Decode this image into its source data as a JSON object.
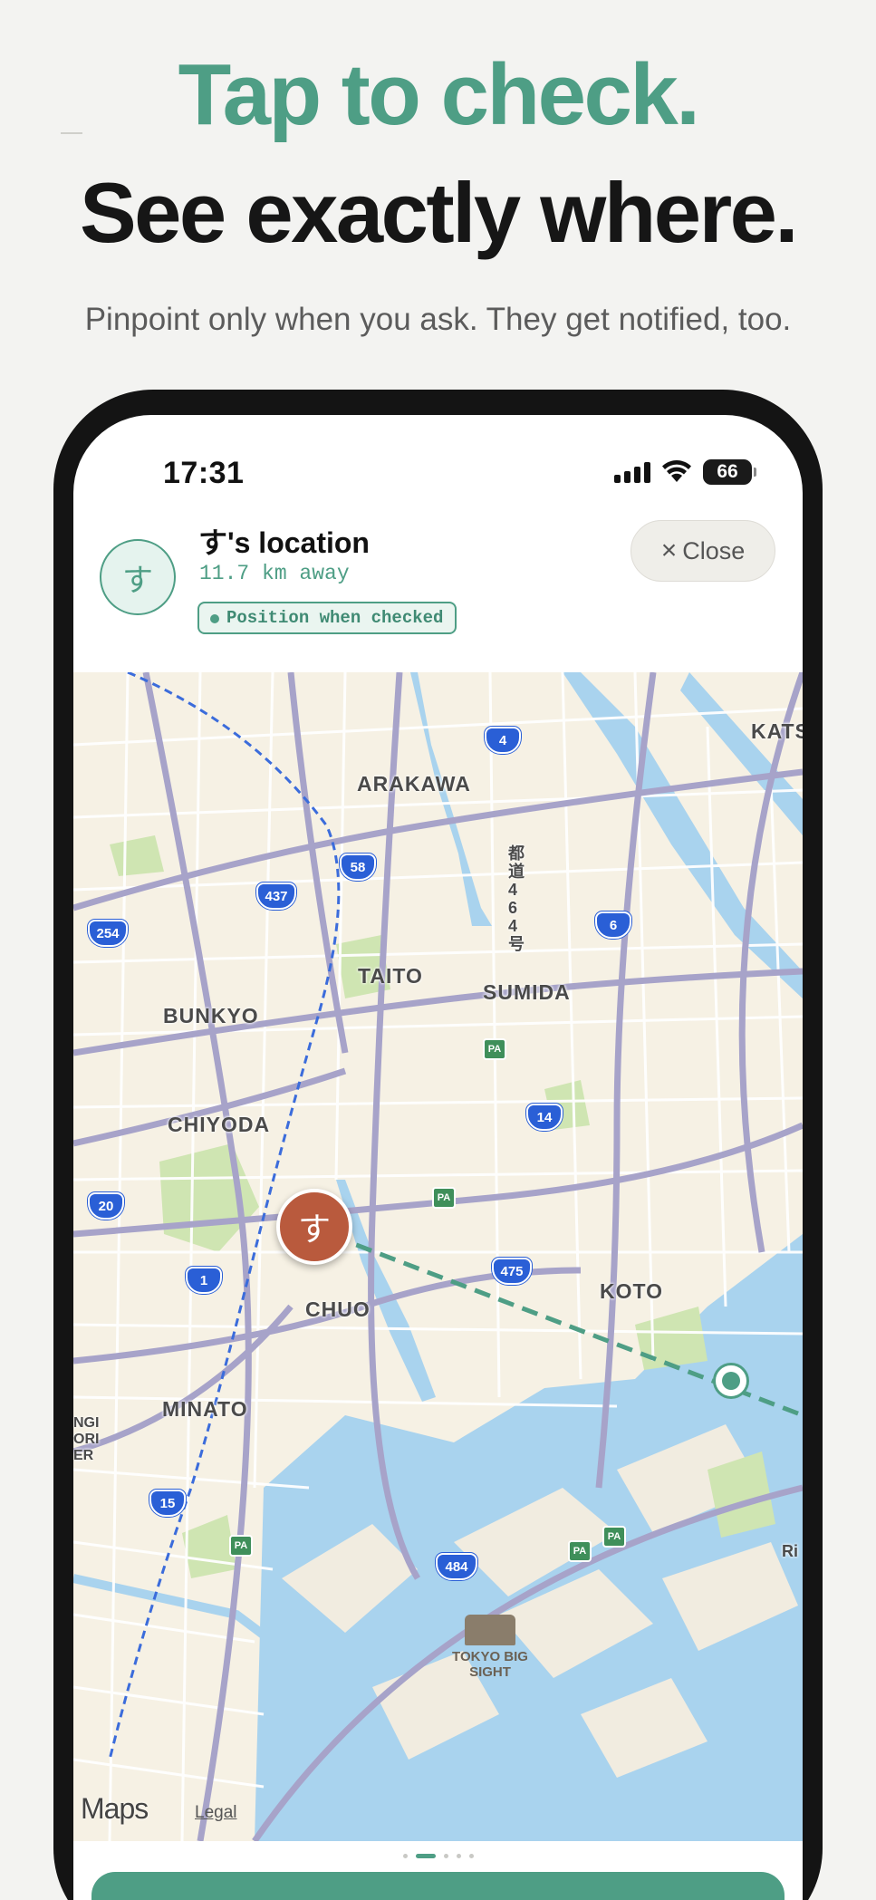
{
  "hero": {
    "headline_primary": "Tap to check.",
    "headline_secondary": "See exactly where.",
    "subhead": "Pinpoint only when you ask. They get notified, too."
  },
  "status_bar": {
    "time": "17:31",
    "battery": "66",
    "battery_level": 0.66,
    "icons": [
      "cellular-signal-icon",
      "wifi-icon",
      "battery-icon"
    ]
  },
  "location_header": {
    "avatar_initial": "す",
    "title": "す's location",
    "distance": "11.7 km away",
    "badge": "Position when checked",
    "close_label": "Close",
    "close_icon": "close-icon"
  },
  "map": {
    "district_labels": [
      "ARAKAWA",
      "TAITO",
      "SUMIDA",
      "BUNKYO",
      "CHIYODA",
      "CHUO",
      "KOTO",
      "MINATO",
      "KATS"
    ],
    "route_shields": [
      "4",
      "58",
      "437",
      "254",
      "6",
      "14",
      "20",
      "1",
      "475",
      "15",
      "484"
    ],
    "rest_area_label": "PA",
    "vertical_road_label": "都道464号",
    "edge_labels": [
      "NGI",
      "ORI",
      "ER",
      "Ri"
    ],
    "poi": "TOKYO BIG SIGHT",
    "person_pin_initial": "す",
    "attribution": "Maps",
    "legal": "Legal"
  },
  "pager": {
    "count": 5,
    "active_index": 1
  },
  "colors": {
    "accent": "#4e9e85",
    "person_pin": "#b95a3d",
    "background": "#f3f3f1",
    "water": "#a9d3ee",
    "highway_shield": "#2a5fd6"
  }
}
